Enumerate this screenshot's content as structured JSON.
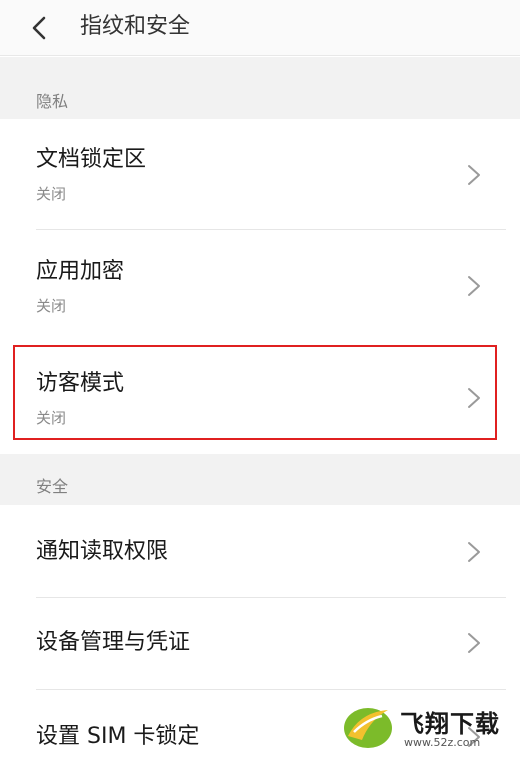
{
  "header": {
    "title": "指纹和安全"
  },
  "sections": {
    "privacy": {
      "label": "隐私"
    },
    "security": {
      "label": "安全"
    }
  },
  "rows": {
    "doc_lock": {
      "title": "文档锁定区",
      "subtitle": "关闭"
    },
    "app_encrypt": {
      "title": "应用加密",
      "subtitle": "关闭"
    },
    "guest_mode": {
      "title": "访客模式",
      "subtitle": "关闭"
    },
    "notify_read": {
      "title": "通知读取权限"
    },
    "device_admin": {
      "title": "设备管理与凭证"
    },
    "sim_lock": {
      "title": "设置 SIM 卡锁定"
    }
  },
  "watermark": {
    "text": "飞翔下载",
    "url": "www.52z.com"
  },
  "colors": {
    "highlight": "#e02020",
    "watermark_green": "#7cbb2a",
    "watermark_yellow": "#f2c12e"
  }
}
